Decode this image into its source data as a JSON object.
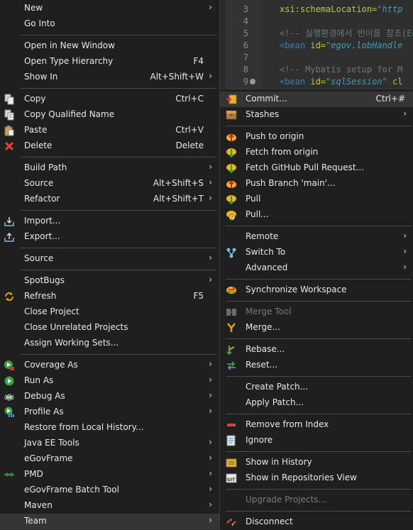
{
  "editor": {
    "lines": [
      {
        "num": "3",
        "attr": "xsi:schemaLocation=",
        "str": "\"http"
      },
      {
        "num": "4"
      },
      {
        "num": "5",
        "comment": "<!-- 실행환경에서 빈이름 참조(Ego"
      },
      {
        "num": "6",
        "tag": "<bean ",
        "attr": "id=",
        "str": "\"egov.lobHandle"
      },
      {
        "num": "7"
      },
      {
        "num": "8",
        "comment": "<!-- Mybatis setup for M"
      },
      {
        "num": "9",
        "tag": "<bean ",
        "attr": "id=",
        "str": "\"sqlSession\"",
        "tail": " cl"
      }
    ]
  },
  "left_menu": {
    "items": [
      {
        "label": "New",
        "arrow": "›"
      },
      {
        "label": "Go Into"
      },
      {
        "label": "Open in New Window"
      },
      {
        "label": "Open Type Hierarchy",
        "accel": "F4"
      },
      {
        "label": "Show In",
        "accel": "Alt+Shift+W",
        "arrow": "›"
      },
      {
        "label": "Copy",
        "accel": "Ctrl+C",
        "icon": "copy-icon"
      },
      {
        "label": "Copy Qualified Name",
        "icon": "copy-qualified-name-icon"
      },
      {
        "label": "Paste",
        "accel": "Ctrl+V",
        "icon": "paste-icon"
      },
      {
        "label": "Delete",
        "accel": "Delete",
        "icon": "delete-icon"
      },
      {
        "label": "Build Path",
        "arrow": "›"
      },
      {
        "label": "Source",
        "accel": "Alt+Shift+S",
        "arrow": "›"
      },
      {
        "label": "Refactor",
        "accel": "Alt+Shift+T",
        "arrow": "›"
      },
      {
        "label": "Import...",
        "icon": "import-icon"
      },
      {
        "label": "Export...",
        "icon": "export-icon"
      },
      {
        "label": "Source",
        "arrow": "›"
      },
      {
        "label": "SpotBugs",
        "arrow": "›"
      },
      {
        "label": "Refresh",
        "accel": "F5",
        "icon": "refresh-icon"
      },
      {
        "label": "Close Project"
      },
      {
        "label": "Close Unrelated Projects"
      },
      {
        "label": "Assign Working Sets..."
      },
      {
        "label": "Coverage As",
        "arrow": "›",
        "icon": "coverage-icon"
      },
      {
        "label": "Run As",
        "arrow": "›",
        "icon": "run-icon"
      },
      {
        "label": "Debug As",
        "arrow": "›",
        "icon": "debug-icon"
      },
      {
        "label": "Profile As",
        "arrow": "›",
        "icon": "profile-icon"
      },
      {
        "label": "Restore from Local History..."
      },
      {
        "label": "Java EE Tools",
        "arrow": "›"
      },
      {
        "label": "eGovFrame",
        "arrow": "›"
      },
      {
        "label": "PMD",
        "arrow": "›",
        "icon": "pmd-icon"
      },
      {
        "label": "eGovFrame Batch Tool",
        "arrow": "›"
      },
      {
        "label": "Maven",
        "arrow": "›"
      },
      {
        "label": "Team",
        "arrow": "›"
      }
    ]
  },
  "team_menu": {
    "items": [
      {
        "label": "Commit...",
        "accel": "Ctrl+#",
        "icon": "commit-icon"
      },
      {
        "label": "Stashes",
        "arrow": "›",
        "icon": "stashes-icon"
      },
      {
        "label": "Push to origin",
        "icon": "push-icon"
      },
      {
        "label": "Fetch from origin",
        "icon": "fetch-icon"
      },
      {
        "label": "Fetch GitHub Pull Request...",
        "icon": "fetch-pull-request-icon"
      },
      {
        "label": "Push Branch 'main'...",
        "icon": "push-branch-icon"
      },
      {
        "label": "Pull",
        "icon": "pull-icon"
      },
      {
        "label": "Pull...",
        "icon": "pull-dialog-icon"
      },
      {
        "label": "Remote",
        "arrow": "›"
      },
      {
        "label": "Switch To",
        "arrow": "›",
        "icon": "switch-branch-icon"
      },
      {
        "label": "Advanced",
        "arrow": "›"
      },
      {
        "label": "Synchronize Workspace",
        "icon": "synchronize-icon"
      },
      {
        "label": "Merge Tool",
        "icon": "merge-tool-icon"
      },
      {
        "label": "Merge...",
        "icon": "merge-icon"
      },
      {
        "label": "Rebase...",
        "icon": "rebase-icon"
      },
      {
        "label": "Reset...",
        "icon": "reset-icon"
      },
      {
        "label": "Create Patch..."
      },
      {
        "label": "Apply Patch..."
      },
      {
        "label": "Remove from Index",
        "icon": "remove-from-index-icon"
      },
      {
        "label": "Ignore",
        "icon": "ignore-icon"
      },
      {
        "label": "Show in History",
        "icon": "history-icon"
      },
      {
        "label": "Show in Repositories View",
        "icon": "git-repositories-icon"
      },
      {
        "label": "Upgrade Projects..."
      },
      {
        "label": "Disconnect",
        "icon": "disconnect-icon"
      }
    ]
  },
  "colors": {
    "menu_bg": "#1f1f1f",
    "highlight": "#353535",
    "separator": "#4a4a4a",
    "disabled_text": "#7a7a7a"
  }
}
